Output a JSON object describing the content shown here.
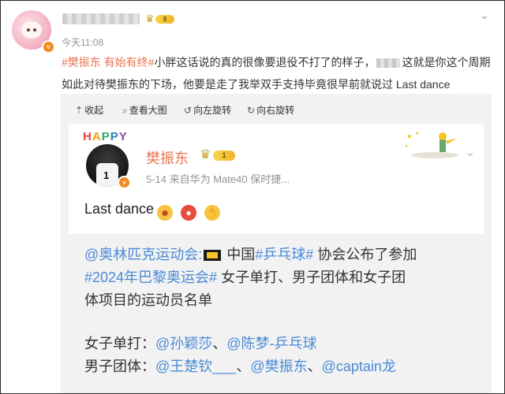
{
  "post": {
    "time": "今天11:08",
    "topic": "#樊振东 有始有终#",
    "text_part1": "小胖这话说的真的很像要退役不打了的样子，",
    "text_part2": "这就是你这个周期如此对待樊振东的下场，他要是走了我举双手支持毕竟很早前就说过 Last dance",
    "member_level": "8"
  },
  "toolbar": {
    "collapse": "收起",
    "view_large": "查看大图",
    "rotate_left": "向左旋转",
    "rotate_right": "向右旋转"
  },
  "icons": {
    "collapse": "up-arrow-icon",
    "view_large": "magnifier-icon",
    "rotate_left": "rotate-left-icon",
    "rotate_right": "rotate-right-icon",
    "more": "chevron-down-icon"
  },
  "card": {
    "happy": [
      "H",
      "A",
      "P",
      "P",
      "Y"
    ],
    "author_name": "樊振东",
    "member_level": "1",
    "meta": "5-14 来自华为 Mate40 保时捷...",
    "body": "Last dance",
    "jersey_number": "1"
  },
  "repost": {
    "mention_org": "@奥林匹克运动会:",
    "country": "中国",
    "topic_pingpong": "#乒乓球#",
    "text1": "协会公布了参加",
    "topic_paris": "#2024年巴黎奥运会#",
    "text2": "女子单打、男子团体和女子团",
    "text3": "体项目的运动员名单",
    "womens_singles_label": "女子单打：",
    "w1": "@孙颖莎",
    "sep": "、",
    "w2": "@陈梦-乒乓球",
    "mens_team_label": "男子团体：",
    "m1": "@王楚钦___",
    "m2": "@樊振东",
    "m3": "@captain龙"
  },
  "colors": {
    "topic": "#eb7350",
    "link": "#4a8ad6",
    "repost_bg": "#f2f2f2",
    "meta_gray": "#939393"
  }
}
